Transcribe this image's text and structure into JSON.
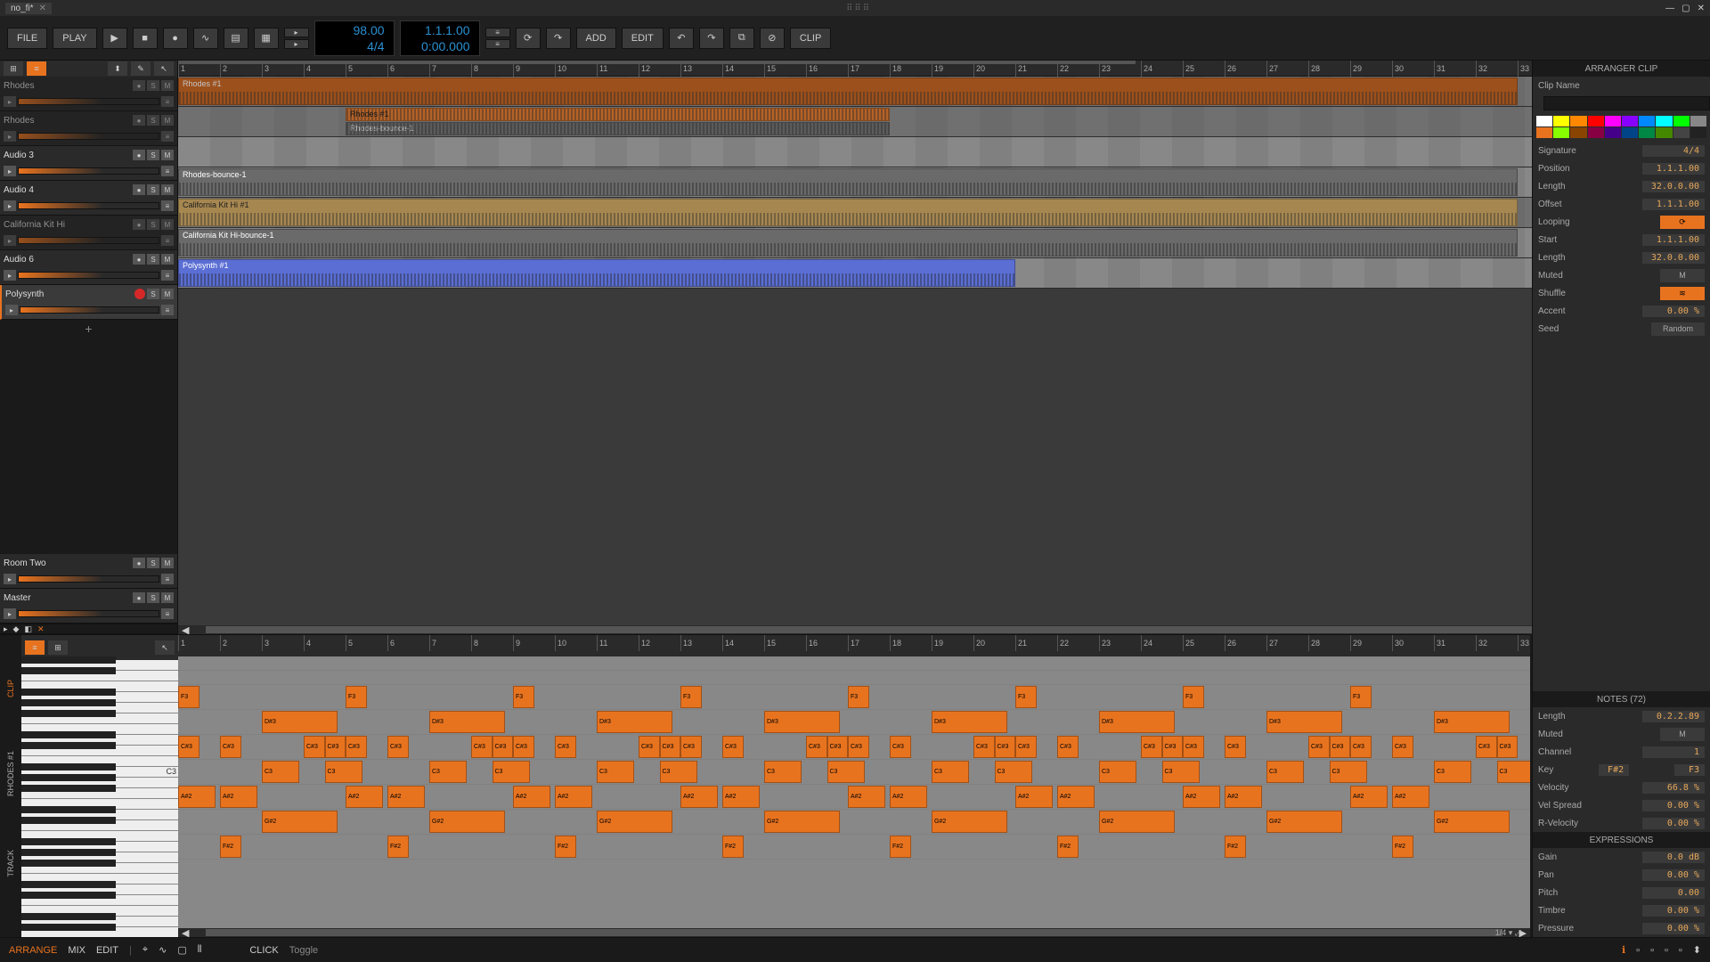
{
  "title": {
    "project": "no_fi*"
  },
  "toolbar": {
    "file": "FILE",
    "play": "PLAY",
    "add": "ADD",
    "edit": "EDIT",
    "clip": "CLIP",
    "tempo": "98.00",
    "sig": "4/4",
    "pos": "1.1.1.00",
    "time": "0:00.000"
  },
  "tracks": [
    {
      "name": "Rhodes",
      "dim": true
    },
    {
      "name": "Rhodes",
      "dim": true
    },
    {
      "name": "Audio 3",
      "dim": false
    },
    {
      "name": "Audio 4",
      "dim": false
    },
    {
      "name": "California Kit Hi",
      "dim": true
    },
    {
      "name": "Audio 6",
      "dim": false
    },
    {
      "name": "Polysynth",
      "dim": false,
      "armed": true
    }
  ],
  "busTracks": [
    {
      "name": "Room Two"
    },
    {
      "name": "Master"
    }
  ],
  "clips": [
    {
      "track": 0,
      "name": "Rhodes #1",
      "start": 1,
      "len": 32,
      "cls": "orange-dark"
    },
    {
      "track": 1,
      "name": "Rhodes #1",
      "start": 5,
      "len": 13,
      "cls": "orange",
      "sub": true
    },
    {
      "track": 1,
      "name": "Rhodes-bounce-1",
      "start": 5,
      "len": 13,
      "cls": "grey",
      "sub2": true
    },
    {
      "track": 3,
      "name": "Rhodes-bounce-1",
      "start": 1,
      "len": 32,
      "cls": "grey"
    },
    {
      "track": 4,
      "name": "California Kit Hi #1",
      "start": 1,
      "len": 32,
      "cls": "tan"
    },
    {
      "track": 5,
      "name": "California Kit Hi-bounce-1",
      "start": 1,
      "len": 32,
      "cls": "grey"
    },
    {
      "track": 6,
      "name": "Polysynth #1",
      "start": 1,
      "len": 20,
      "cls": "blue"
    }
  ],
  "ruler_max": 33,
  "inspector": {
    "title": "ARRANGER CLIP",
    "clipName": "Clip Name",
    "signature": {
      "label": "Signature",
      "val": "4/4"
    },
    "position": {
      "label": "Position",
      "val": "1.1.1.00"
    },
    "length": {
      "label": "Length",
      "val": "32.0.0.00"
    },
    "offset": {
      "label": "Offset",
      "val": "1.1.1.00"
    },
    "looping": {
      "label": "Looping",
      "on": true
    },
    "loopStart": {
      "label": "Start",
      "val": "1.1.1.00"
    },
    "loopLength": {
      "label": "Length",
      "val": "32.0.0.00"
    },
    "muted": {
      "label": "Muted",
      "btn": "M"
    },
    "shuffle": {
      "label": "Shuffle",
      "on": true
    },
    "accent": {
      "label": "Accent",
      "val": "0.00 %"
    },
    "seed": {
      "label": "Seed",
      "btn": "Random"
    },
    "colors": [
      "#fff",
      "#ff0",
      "#f80",
      "#f00",
      "#f0f",
      "#80f",
      "#08f",
      "#0ff",
      "#0f0",
      "#888",
      "#e8731f",
      "#8f0",
      "#840",
      "#804",
      "#408",
      "#048",
      "#084",
      "#480",
      "#444",
      "#222"
    ]
  },
  "notesPanel": {
    "title": "NOTES (72)",
    "length": {
      "label": "Length",
      "val": "0.2.2.89"
    },
    "muted": {
      "label": "Muted",
      "btn": "M"
    },
    "channel": {
      "label": "Channel",
      "val": "1"
    },
    "key": {
      "label": "Key",
      "low": "F#2",
      "hi": "F3"
    },
    "velocity": {
      "label": "Velocity",
      "val": "66.8 %"
    },
    "velSpread": {
      "label": "Vel Spread",
      "val": "0.00 %"
    },
    "rVelocity": {
      "label": "R-Velocity",
      "val": "0.00 %"
    },
    "exprTitle": "EXPRESSIONS",
    "gain": {
      "label": "Gain",
      "val": "0.0 dB"
    },
    "pan": {
      "label": "Pan",
      "val": "0.00 %"
    },
    "pitch": {
      "label": "Pitch",
      "val": "0.00"
    },
    "timbre": {
      "label": "Timbre",
      "val": "0.00 %"
    },
    "pressure": {
      "label": "Pressure",
      "val": "0.00 %"
    }
  },
  "editor": {
    "clipTab": "CLIP",
    "trackTab": "TRACK",
    "clipName": "RHODES #1",
    "keyLabel": "C3",
    "notes": [
      "F3",
      "D#3",
      "C#3",
      "C3",
      "A#2",
      "G#2",
      "F#2"
    ],
    "zoom": "1/4"
  },
  "footer": {
    "arrange": "ARRANGE",
    "mix": "MIX",
    "edit": "EDIT",
    "click": "CLICK",
    "toggle": "Toggle"
  },
  "arranger_zoom": "1/4"
}
